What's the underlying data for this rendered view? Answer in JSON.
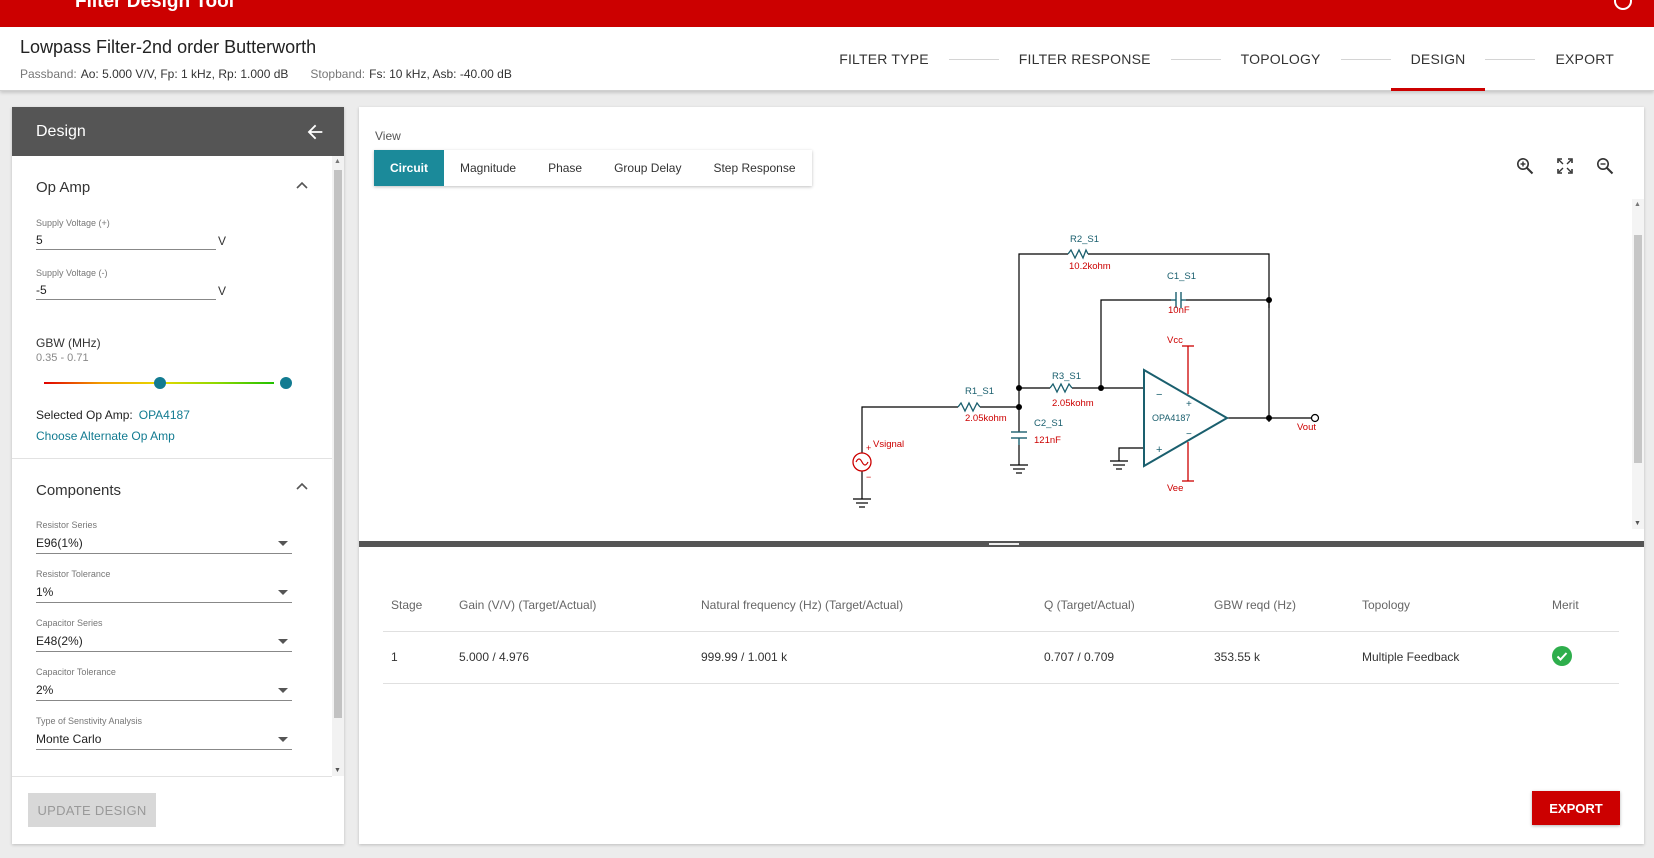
{
  "app": {
    "title": "Filter Design Tool"
  },
  "header": {
    "title": "Lowpass Filter-2nd order Butterworth",
    "passband_label": "Passband:",
    "passband_value": "Ao: 5.000 V/V, Fp: 1 kHz, Rp: 1.000 dB",
    "stopband_label": "Stopband:",
    "stopband_value": "Fs: 10 kHz, Asb: -40.00 dB",
    "steps": [
      "FILTER TYPE",
      "FILTER RESPONSE",
      "TOPOLOGY",
      "DESIGN",
      "EXPORT"
    ],
    "active_step": "DESIGN",
    "accent_color": "#cc0000"
  },
  "design_panel": {
    "title": "Design",
    "opamp_section": "Op Amp",
    "supply_pos_label": "Supply Voltage (+)",
    "supply_pos_value": "5",
    "supply_neg_label": "Supply Voltage (-)",
    "supply_neg_value": "-5",
    "unit": "V",
    "gbw_label": "GBW (MHz)",
    "gbw_range": "0.35 - 0.71",
    "selected_opamp_label": "Selected Op Amp:",
    "selected_opamp_value": "OPA4187",
    "alternate_link": "Choose Alternate Op Amp",
    "components_section": "Components",
    "resistor_series_label": "Resistor Series",
    "resistor_series_value": "E96(1%)",
    "resistor_tol_label": "Resistor Tolerance",
    "resistor_tol_value": "1%",
    "capacitor_series_label": "Capacitor Series",
    "capacitor_series_value": "E48(2%)",
    "capacitor_tol_label": "Capacitor Tolerance",
    "capacitor_tol_value": "2%",
    "sensitivity_label": "Type of Senstivity Analysis",
    "sensitivity_value": "Monte Carlo",
    "update_button": "UPDATE DESIGN"
  },
  "view": {
    "label": "View",
    "tabs": [
      "Circuit",
      "Magnitude",
      "Phase",
      "Group Delay",
      "Step Response"
    ],
    "active_tab": "Circuit"
  },
  "circuit": {
    "r2": "R2_S1",
    "r2_val": "10.2kohm",
    "c1": "C1_S1",
    "c1_val": "10nF",
    "r1": "R1_S1",
    "r1_val": "2.05kohm",
    "r3": "R3_S1",
    "r3_val": "2.05kohm",
    "c2": "C2_S1",
    "c2_val": "121nF",
    "opamp": "OPA4187",
    "vcc": "Vcc",
    "vee": "Vee",
    "source": "Vsignal",
    "output": "Vout",
    "wire_color": "#000000",
    "component_color": "#1a5f6e",
    "value_color": "#cc0000"
  },
  "results": {
    "headers": [
      "Stage",
      "Gain (V/V) (Target/Actual)",
      "Natural frequency (Hz) (Target/Actual)",
      "Q (Target/Actual)",
      "GBW reqd (Hz)",
      "Topology",
      "Merit"
    ],
    "rows": [
      {
        "stage": "1",
        "gain": "5.000 / 4.976",
        "freq": "999.99 / 1.001 k",
        "q": "0.707 / 0.709",
        "gbw": "353.55 k",
        "topology": "Multiple Feedback",
        "merit": "check-circle-icon"
      }
    ]
  },
  "export_button": "EXPORT"
}
